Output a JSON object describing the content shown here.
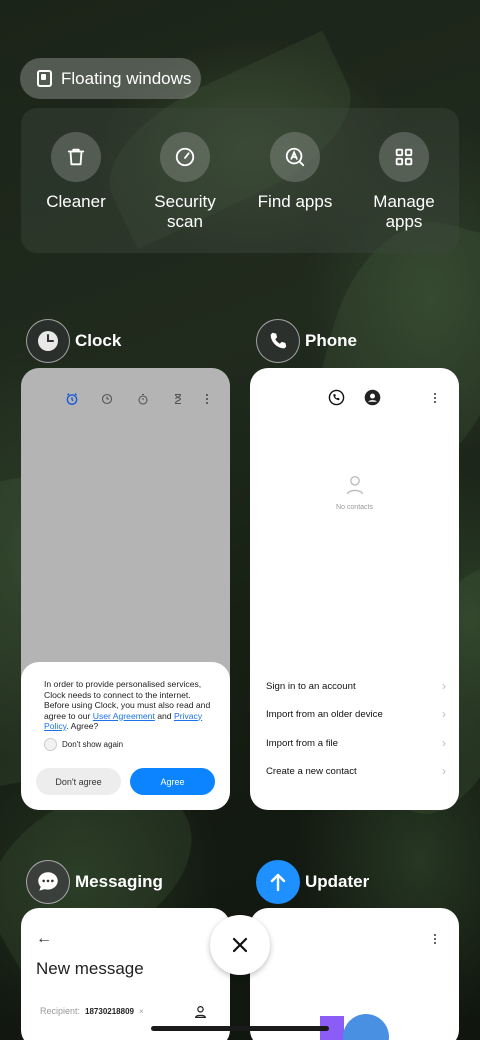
{
  "floating_windows": {
    "label": "Floating windows",
    "icon": "floating-window-icon"
  },
  "actions": [
    {
      "label": "Cleaner",
      "icon": "trash-icon"
    },
    {
      "label": "Security scan",
      "icon": "speedometer-icon"
    },
    {
      "label": "Find apps",
      "icon": "search-app-icon"
    },
    {
      "label": "Manage apps",
      "icon": "grid-icon"
    }
  ],
  "apps": {
    "clock": {
      "name": "Clock",
      "dialog": {
        "message_start": "In order to provide personalised services, Clock needs to connect to the internet. Before using Clock, you must also read and agree to our ",
        "link_agreement": "User Agreement",
        "message_and": " and ",
        "link_privacy": "Privacy Policy",
        "message_end": ". Agree?",
        "checkbox_label": "Don't show again",
        "disagree_label": "Don't agree",
        "agree_label": "Agree"
      }
    },
    "phone": {
      "name": "Phone",
      "empty_text": "No contacts",
      "items": [
        "Sign in to an account",
        "Import from an older device",
        "Import from a file",
        "Create a new contact"
      ]
    },
    "messaging": {
      "name": "Messaging",
      "title": "New message",
      "recipient_label": "Recipient:",
      "recipient_value": "18730218809"
    },
    "updater": {
      "name": "Updater"
    }
  },
  "colors": {
    "accent_blue": "#0d84ff",
    "updater_icon": "#1e90ff"
  }
}
